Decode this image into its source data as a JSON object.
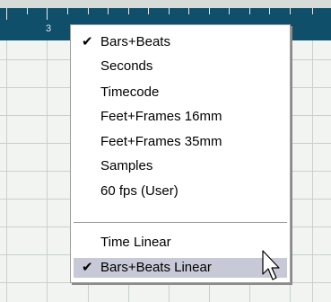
{
  "ruler": {
    "bar_number": "3"
  },
  "menu": {
    "items": [
      {
        "label": "Bars+Beats",
        "checked": true
      },
      {
        "label": "Seconds",
        "checked": false
      },
      {
        "label": "Timecode",
        "checked": false
      },
      {
        "label": "Feet+Frames 16mm",
        "checked": false
      },
      {
        "label": "Feet+Frames 35mm",
        "checked": false
      },
      {
        "label": "Samples",
        "checked": false
      },
      {
        "label": "60 fps (User)",
        "checked": false
      }
    ],
    "view_items": [
      {
        "label": "Time Linear",
        "checked": false
      },
      {
        "label": "Bars+Beats Linear",
        "checked": true
      }
    ],
    "check_glyph": "✔"
  },
  "colors": {
    "ruler": "#0f4f6a",
    "grid_line": "#bfc8c3",
    "grid_bg": "#eef1ee",
    "highlight": "#c7c9d6"
  }
}
